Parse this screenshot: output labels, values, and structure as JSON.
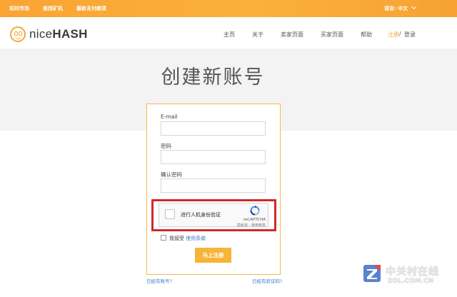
{
  "topbar": {
    "links": [
      "实时市场",
      "查找矿机",
      "最新支付款项"
    ],
    "language": "语言: 中文"
  },
  "header": {
    "logo_text_light": "nice",
    "logo_text_bold": "HASH",
    "nav": [
      "主页",
      "关于",
      "卖家页面",
      "买家页面",
      "帮助"
    ],
    "register": "注册",
    "separator": "/",
    "login": "登录"
  },
  "main": {
    "title": "创建新账号"
  },
  "form": {
    "email_label": "E-mail",
    "email_value": "",
    "password_label": "密码",
    "password_value": "",
    "confirm_label": "确认密码",
    "confirm_value": "",
    "recaptcha": {
      "label": "进行人机身份验证",
      "brand": "reCAPTCHA",
      "privacy": "隐私权 - 使用条款"
    },
    "accept_text": "我接受",
    "terms_link": "使用条款",
    "submit_label": "马上注册",
    "have_account_link": "已经有账号?",
    "have_code_link": "已经有验证码?"
  },
  "watermark": {
    "chinese": "中关村在线",
    "english": "ZOL.COM.CN"
  },
  "colors": {
    "brand_orange": "#f5a83c",
    "highlight_red": "#cf2a2a",
    "link_blue": "#3a7cc7"
  }
}
